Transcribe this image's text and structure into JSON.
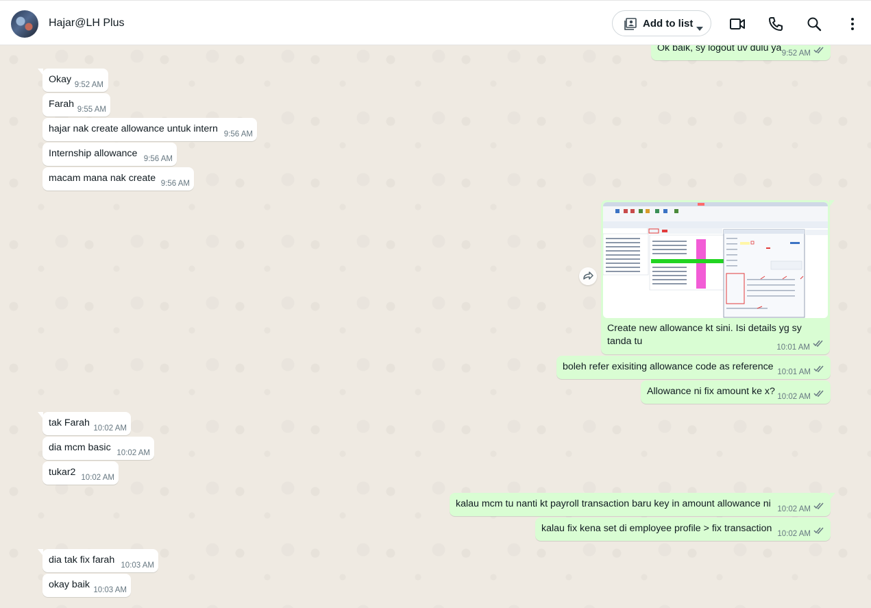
{
  "header": {
    "contact_name": "Hajar@LH Plus",
    "add_to_list_label": "Add to list",
    "icons": [
      "add-to-list-icon",
      "dropdown-caret-icon",
      "video-call-icon",
      "voice-call-icon",
      "search-icon",
      "menu-icon"
    ]
  },
  "colors": {
    "incoming_bubble": "#ffffff",
    "outgoing_bubble": "#d9fdd3",
    "chat_background": "#efeae2",
    "tick_color": "#667781"
  },
  "messages": [
    {
      "dir": "out",
      "text": "Ok baik, sy logout uv dulu ya",
      "time": "9:52 AM"
    },
    {
      "dir": "in",
      "text": "Okay",
      "time": "9:52 AM"
    },
    {
      "dir": "in",
      "text": "Farah",
      "time": "9:55 AM"
    },
    {
      "dir": "in",
      "text": "hajar nak create allowance untuk intern",
      "time": "9:56 AM"
    },
    {
      "dir": "in",
      "text": "Internship allowance",
      "time": "9:56 AM"
    },
    {
      "dir": "in",
      "text": "macam mana nak create",
      "time": "9:56 AM"
    },
    {
      "dir": "out",
      "type": "image",
      "caption": "Create new allowance kt sini. Isi details yg sy tanda tu",
      "time": "10:01 AM"
    },
    {
      "dir": "out",
      "text": "boleh refer exisiting allowance code as reference",
      "time": "10:01 AM"
    },
    {
      "dir": "out",
      "text": "Allowance ni fix amount ke x?",
      "time": "10:02 AM"
    },
    {
      "dir": "in",
      "text": "tak Farah",
      "time": "10:02 AM"
    },
    {
      "dir": "in",
      "text": "dia mcm basic",
      "time": "10:02 AM"
    },
    {
      "dir": "in",
      "text": "tukar2",
      "time": "10:02 AM"
    },
    {
      "dir": "out",
      "text": "kalau mcm tu nanti kt payroll transaction baru key in amount allowance ni",
      "time": "10:02 AM"
    },
    {
      "dir": "out",
      "text": "kalau fix kena set di employee profile > fix transaction",
      "time": "10:02 AM"
    },
    {
      "dir": "in",
      "text": "dia tak fix farah",
      "time": "10:03 AM"
    },
    {
      "dir": "in",
      "text": "okay baik",
      "time": "10:03 AM"
    }
  ]
}
